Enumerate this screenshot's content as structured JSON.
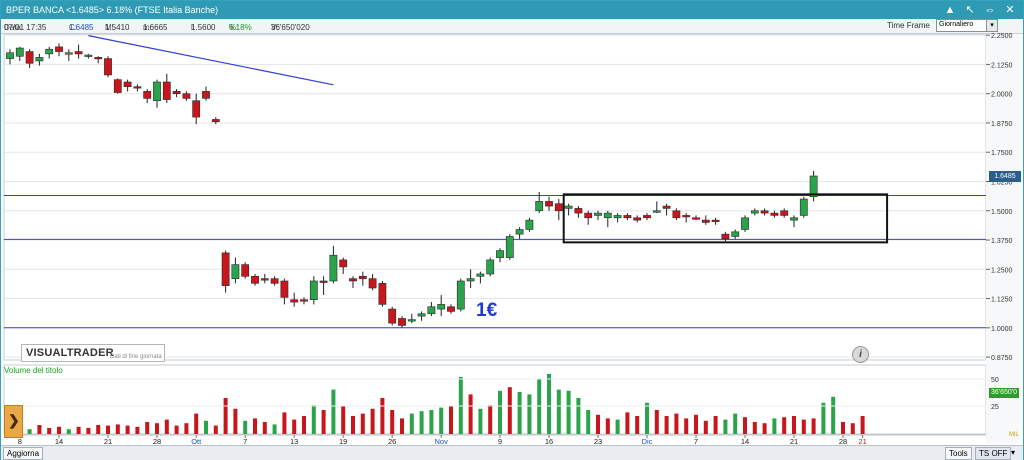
{
  "window": {
    "title": "BPER BANCA <1.6485> 6.18%  (FTSE Italia Banche)",
    "controls": [
      "▲",
      "↖",
      "⇔",
      "✕"
    ]
  },
  "infobar": {
    "date_label": "Data:",
    "date": "07/01 17:35",
    "c_label": "C:",
    "c": "1.6485",
    "M_label": "M:",
    "M": "1.5410",
    "m_label": "m:",
    "m": "1.6665",
    "l_label": "l:",
    "l": "1.5600",
    "pct_label": "%:",
    "pct": "6.18%",
    "v_label": "V:",
    "v": "36'650'020",
    "timeframe_label": "Time Frame",
    "timeframe_value": "Giornaliero"
  },
  "brand": {
    "name": "VISUALTRADER",
    "subtitle": "Dati di fine giornata"
  },
  "volume_label": "Volume del titolo",
  "volume_badge": "36'650'0",
  "price_badge": "1.6485",
  "mil_tag": "MIL",
  "annotation": "1€",
  "bottom": {
    "left_button": "Aggiorna",
    "tools": "Tools",
    "ts_off": "TS OFF"
  },
  "colors": {
    "up": "#2aa34a",
    "down": "#c8161d",
    "hline": "#3b3bdc",
    "trend": "#2a3fd3",
    "frame": "#33a2bd"
  },
  "chart_data": {
    "type": "candlestick",
    "y_ticks": [
      "2.2500",
      "2.1250",
      "2.0000",
      "1.8750",
      "1.7500",
      "1.6250",
      "1.5000",
      "1.3750",
      "1.2500",
      "1.1250",
      "1.0000",
      "0.8750"
    ],
    "ylim": [
      0.8625,
      2.255
    ],
    "x_tick_labels": [
      "8",
      "14",
      "21",
      "28",
      "Ott",
      "7",
      "13",
      "19",
      "26",
      "Nov",
      "9",
      "16",
      "23",
      "Dic",
      "7",
      "14",
      "21",
      "28",
      "21"
    ],
    "x_tick_candle_index": [
      1,
      5,
      10,
      15,
      19,
      24,
      29,
      34,
      39,
      44,
      50,
      55,
      60,
      65,
      70,
      75,
      80,
      85,
      87
    ],
    "horizontal_lines": [
      1.565,
      1.3775,
      1.0
    ],
    "trendline": {
      "from": {
        "candle": 8,
        "y": 2.248
      },
      "to": {
        "candle": 33,
        "y": 2.038
      }
    },
    "box": {
      "from_candle": 56.5,
      "to_candle": 89.5,
      "top": 1.57,
      "bottom": 1.365
    },
    "candles": [
      {
        "o": 2.15,
        "h": 2.19,
        "l": 2.125,
        "c": 2.175
      },
      {
        "o": 2.16,
        "h": 2.2,
        "l": 2.14,
        "c": 2.195
      },
      {
        "o": 2.18,
        "h": 2.19,
        "l": 2.11,
        "c": 2.13
      },
      {
        "o": 2.14,
        "h": 2.17,
        "l": 2.12,
        "c": 2.155
      },
      {
        "o": 2.17,
        "h": 2.2,
        "l": 2.15,
        "c": 2.19
      },
      {
        "o": 2.2,
        "h": 2.215,
        "l": 2.16,
        "c": 2.18
      },
      {
        "o": 2.17,
        "h": 2.19,
        "l": 2.14,
        "c": 2.175
      },
      {
        "o": 2.18,
        "h": 2.21,
        "l": 2.15,
        "c": 2.17
      },
      {
        "o": 2.16,
        "h": 2.17,
        "l": 2.15,
        "c": 2.165
      },
      {
        "o": 2.155,
        "h": 2.16,
        "l": 2.13,
        "c": 2.15
      },
      {
        "o": 2.15,
        "h": 2.16,
        "l": 2.07,
        "c": 2.08
      },
      {
        "o": 2.06,
        "h": 2.065,
        "l": 2.0,
        "c": 2.005
      },
      {
        "o": 2.05,
        "h": 2.06,
        "l": 2.01,
        "c": 2.03
      },
      {
        "o": 2.03,
        "h": 2.04,
        "l": 2.01,
        "c": 2.025
      },
      {
        "o": 2.01,
        "h": 2.02,
        "l": 1.96,
        "c": 1.98
      },
      {
        "o": 1.97,
        "h": 2.06,
        "l": 1.94,
        "c": 2.05
      },
      {
        "o": 2.05,
        "h": 2.085,
        "l": 1.96,
        "c": 1.975
      },
      {
        "o": 2.01,
        "h": 2.02,
        "l": 1.985,
        "c": 2.0
      },
      {
        "o": 2.0,
        "h": 2.01,
        "l": 1.97,
        "c": 1.98
      },
      {
        "o": 1.97,
        "h": 2.0,
        "l": 1.87,
        "c": 1.9
      },
      {
        "o": 2.01,
        "h": 2.03,
        "l": 1.97,
        "c": 1.98
      },
      {
        "o": 1.89,
        "h": 1.9,
        "l": 1.87,
        "c": 1.88
      },
      {
        "o": 1.32,
        "h": 1.33,
        "l": 1.15,
        "c": 1.18
      },
      {
        "o": 1.21,
        "h": 1.3,
        "l": 1.19,
        "c": 1.27
      },
      {
        "o": 1.27,
        "h": 1.28,
        "l": 1.21,
        "c": 1.22
      },
      {
        "o": 1.22,
        "h": 1.23,
        "l": 1.18,
        "c": 1.19
      },
      {
        "o": 1.21,
        "h": 1.23,
        "l": 1.19,
        "c": 1.205
      },
      {
        "o": 1.21,
        "h": 1.22,
        "l": 1.18,
        "c": 1.19
      },
      {
        "o": 1.2,
        "h": 1.21,
        "l": 1.1,
        "c": 1.13
      },
      {
        "o": 1.12,
        "h": 1.15,
        "l": 1.09,
        "c": 1.11
      },
      {
        "o": 1.12,
        "h": 1.13,
        "l": 1.1,
        "c": 1.115
      },
      {
        "o": 1.12,
        "h": 1.22,
        "l": 1.1,
        "c": 1.2
      },
      {
        "o": 1.2,
        "h": 1.22,
        "l": 1.14,
        "c": 1.195
      },
      {
        "o": 1.2,
        "h": 1.35,
        "l": 1.19,
        "c": 1.31
      },
      {
        "o": 1.29,
        "h": 1.3,
        "l": 1.23,
        "c": 1.26
      },
      {
        "o": 1.21,
        "h": 1.22,
        "l": 1.17,
        "c": 1.2
      },
      {
        "o": 1.22,
        "h": 1.24,
        "l": 1.18,
        "c": 1.21
      },
      {
        "o": 1.21,
        "h": 1.23,
        "l": 1.16,
        "c": 1.17
      },
      {
        "o": 1.19,
        "h": 1.2,
        "l": 1.09,
        "c": 1.1
      },
      {
        "o": 1.08,
        "h": 1.09,
        "l": 1.01,
        "c": 1.02
      },
      {
        "o": 1.04,
        "h": 1.05,
        "l": 1.0,
        "c": 1.01
      },
      {
        "o": 1.03,
        "h": 1.06,
        "l": 1.02,
        "c": 1.035
      },
      {
        "o": 1.05,
        "h": 1.07,
        "l": 1.03,
        "c": 1.06
      },
      {
        "o": 1.06,
        "h": 1.11,
        "l": 1.05,
        "c": 1.09
      },
      {
        "o": 1.08,
        "h": 1.14,
        "l": 1.05,
        "c": 1.1
      },
      {
        "o": 1.09,
        "h": 1.1,
        "l": 1.06,
        "c": 1.07
      },
      {
        "o": 1.08,
        "h": 1.21,
        "l": 1.07,
        "c": 1.2
      },
      {
        "o": 1.2,
        "h": 1.25,
        "l": 1.17,
        "c": 1.21
      },
      {
        "o": 1.22,
        "h": 1.24,
        "l": 1.19,
        "c": 1.23
      },
      {
        "o": 1.23,
        "h": 1.3,
        "l": 1.22,
        "c": 1.29
      },
      {
        "o": 1.3,
        "h": 1.34,
        "l": 1.28,
        "c": 1.33
      },
      {
        "o": 1.3,
        "h": 1.4,
        "l": 1.29,
        "c": 1.39
      },
      {
        "o": 1.4,
        "h": 1.43,
        "l": 1.38,
        "c": 1.42
      },
      {
        "o": 1.42,
        "h": 1.47,
        "l": 1.41,
        "c": 1.46
      },
      {
        "o": 1.5,
        "h": 1.58,
        "l": 1.49,
        "c": 1.54
      },
      {
        "o": 1.54,
        "h": 1.56,
        "l": 1.5,
        "c": 1.52
      },
      {
        "o": 1.53,
        "h": 1.55,
        "l": 1.46,
        "c": 1.5
      },
      {
        "o": 1.51,
        "h": 1.53,
        "l": 1.48,
        "c": 1.52
      },
      {
        "o": 1.51,
        "h": 1.52,
        "l": 1.47,
        "c": 1.49
      },
      {
        "o": 1.49,
        "h": 1.5,
        "l": 1.44,
        "c": 1.47
      },
      {
        "o": 1.48,
        "h": 1.5,
        "l": 1.46,
        "c": 1.49
      },
      {
        "o": 1.47,
        "h": 1.5,
        "l": 1.43,
        "c": 1.49
      },
      {
        "o": 1.47,
        "h": 1.49,
        "l": 1.45,
        "c": 1.48
      },
      {
        "o": 1.48,
        "h": 1.49,
        "l": 1.46,
        "c": 1.47
      },
      {
        "o": 1.47,
        "h": 1.48,
        "l": 1.45,
        "c": 1.46
      },
      {
        "o": 1.48,
        "h": 1.49,
        "l": 1.46,
        "c": 1.47
      },
      {
        "o": 1.5,
        "h": 1.54,
        "l": 1.49,
        "c": 1.5
      },
      {
        "o": 1.52,
        "h": 1.53,
        "l": 1.48,
        "c": 1.51
      },
      {
        "o": 1.5,
        "h": 1.51,
        "l": 1.46,
        "c": 1.47
      },
      {
        "o": 1.48,
        "h": 1.49,
        "l": 1.45,
        "c": 1.475
      },
      {
        "o": 1.47,
        "h": 1.48,
        "l": 1.46,
        "c": 1.465
      },
      {
        "o": 1.46,
        "h": 1.48,
        "l": 1.44,
        "c": 1.45
      },
      {
        "o": 1.46,
        "h": 1.47,
        "l": 1.44,
        "c": 1.455
      },
      {
        "o": 1.4,
        "h": 1.41,
        "l": 1.37,
        "c": 1.38
      },
      {
        "o": 1.39,
        "h": 1.42,
        "l": 1.38,
        "c": 1.41
      },
      {
        "o": 1.42,
        "h": 1.48,
        "l": 1.41,
        "c": 1.47
      },
      {
        "o": 1.49,
        "h": 1.51,
        "l": 1.48,
        "c": 1.5
      },
      {
        "o": 1.5,
        "h": 1.51,
        "l": 1.48,
        "c": 1.49
      },
      {
        "o": 1.49,
        "h": 1.5,
        "l": 1.47,
        "c": 1.48
      },
      {
        "o": 1.5,
        "h": 1.51,
        "l": 1.47,
        "c": 1.48
      },
      {
        "o": 1.46,
        "h": 1.48,
        "l": 1.43,
        "c": 1.47
      },
      {
        "o": 1.48,
        "h": 1.56,
        "l": 1.47,
        "c": 1.55
      },
      {
        "o": 1.56,
        "h": 1.67,
        "l": 1.54,
        "c": 1.6485
      }
    ],
    "volume": [
      {
        "v": 0.1,
        "up": false
      },
      {
        "v": 0.12,
        "up": false
      },
      {
        "v": 0.08,
        "up": true
      },
      {
        "v": 0.15,
        "up": false
      },
      {
        "v": 0.1,
        "up": false
      },
      {
        "v": 0.12,
        "up": false
      },
      {
        "v": 0.08,
        "up": true
      },
      {
        "v": 0.12,
        "up": false
      },
      {
        "v": 0.1,
        "up": false
      },
      {
        "v": 0.15,
        "up": false
      },
      {
        "v": 0.14,
        "up": false
      },
      {
        "v": 0.16,
        "up": false
      },
      {
        "v": 0.14,
        "up": false
      },
      {
        "v": 0.12,
        "up": false
      },
      {
        "v": 0.2,
        "up": false
      },
      {
        "v": 0.18,
        "up": false
      },
      {
        "v": 0.24,
        "up": false
      },
      {
        "v": 0.14,
        "up": false
      },
      {
        "v": 0.18,
        "up": false
      },
      {
        "v": 0.34,
        "up": false
      },
      {
        "v": 0.22,
        "up": true
      },
      {
        "v": 0.14,
        "up": false
      },
      {
        "v": 0.6,
        "up": false
      },
      {
        "v": 0.42,
        "up": false
      },
      {
        "v": 0.22,
        "up": true
      },
      {
        "v": 0.26,
        "up": false
      },
      {
        "v": 0.2,
        "up": false
      },
      {
        "v": 0.16,
        "up": true
      },
      {
        "v": 0.36,
        "up": false
      },
      {
        "v": 0.24,
        "up": false
      },
      {
        "v": 0.3,
        "up": false
      },
      {
        "v": 0.48,
        "up": true
      },
      {
        "v": 0.4,
        "up": false
      },
      {
        "v": 0.74,
        "up": true
      },
      {
        "v": 0.46,
        "up": false
      },
      {
        "v": 0.3,
        "up": false
      },
      {
        "v": 0.34,
        "up": false
      },
      {
        "v": 0.42,
        "up": false
      },
      {
        "v": 0.6,
        "up": false
      },
      {
        "v": 0.4,
        "up": false
      },
      {
        "v": 0.26,
        "up": false
      },
      {
        "v": 0.34,
        "up": true
      },
      {
        "v": 0.38,
        "up": true
      },
      {
        "v": 0.4,
        "up": true
      },
      {
        "v": 0.44,
        "up": true
      },
      {
        "v": 0.46,
        "up": false
      },
      {
        "v": 0.95,
        "up": true
      },
      {
        "v": 0.66,
        "up": false
      },
      {
        "v": 0.42,
        "up": true
      },
      {
        "v": 0.48,
        "up": false
      },
      {
        "v": 0.72,
        "up": true
      },
      {
        "v": 0.78,
        "up": false
      },
      {
        "v": 0.7,
        "up": true
      },
      {
        "v": 0.66,
        "up": true
      },
      {
        "v": 0.92,
        "up": true
      },
      {
        "v": 1.0,
        "up": true
      },
      {
        "v": 0.74,
        "up": true
      },
      {
        "v": 0.72,
        "up": true
      },
      {
        "v": 0.6,
        "up": true
      },
      {
        "v": 0.4,
        "up": true
      },
      {
        "v": 0.32,
        "up": false
      },
      {
        "v": 0.26,
        "up": false
      },
      {
        "v": 0.24,
        "up": true
      },
      {
        "v": 0.36,
        "up": false
      },
      {
        "v": 0.3,
        "up": false
      },
      {
        "v": 0.52,
        "up": true
      },
      {
        "v": 0.4,
        "up": false
      },
      {
        "v": 0.3,
        "up": false
      },
      {
        "v": 0.34,
        "up": false
      },
      {
        "v": 0.26,
        "up": false
      },
      {
        "v": 0.32,
        "up": false
      },
      {
        "v": 0.22,
        "up": false
      },
      {
        "v": 0.3,
        "up": false
      },
      {
        "v": 0.24,
        "up": true
      },
      {
        "v": 0.34,
        "up": true
      },
      {
        "v": 0.28,
        "up": false
      },
      {
        "v": 0.2,
        "up": false
      },
      {
        "v": 0.18,
        "up": false
      },
      {
        "v": 0.26,
        "up": true
      },
      {
        "v": 0.28,
        "up": false
      },
      {
        "v": 0.3,
        "up": false
      },
      {
        "v": 0.24,
        "up": false
      },
      {
        "v": 0.26,
        "up": false
      },
      {
        "v": 0.52,
        "up": true
      },
      {
        "v": 0.62,
        "up": true
      },
      {
        "v": 0.2,
        "up": false
      },
      {
        "v": 0.18,
        "up": false
      },
      {
        "v": 0.3,
        "up": false
      }
    ],
    "volume_ticks": [
      "50",
      "25"
    ]
  }
}
